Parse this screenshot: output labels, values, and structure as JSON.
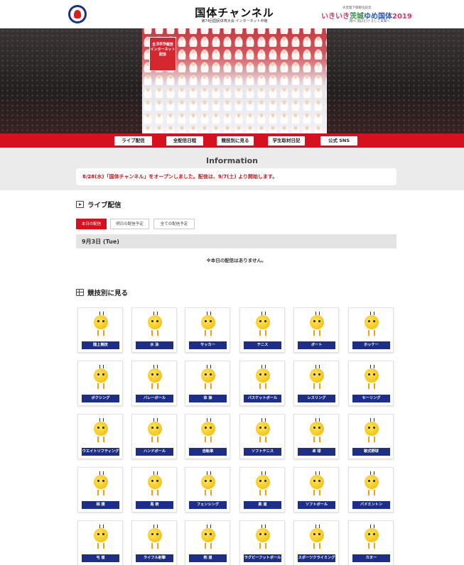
{
  "header": {
    "title": "国体チャンネル",
    "subtitle": "第74回国民体育大会 インターネット中継",
    "right_logo": {
      "small": "天皇陛下御即位記念",
      "name_part1": "いきいき",
      "name_part2": "茨城",
      "name_part3": "ゆめ国体",
      "year": "2019",
      "tagline": "翔べ 羽ばたけ そして未来へ"
    }
  },
  "hero": {
    "badge_line1": "全",
    "badge_number": "389",
    "badge_line2": "競技",
    "badge_line3": "インターネット",
    "badge_line4": "配信"
  },
  "nav": [
    {
      "label": "ライブ配信"
    },
    {
      "label": "全配信日程"
    },
    {
      "label": "競技別に見る"
    },
    {
      "label": "学生取材日記"
    },
    {
      "label": "公式 SNS"
    }
  ],
  "information": {
    "title": "Information",
    "message": "8/28(水)「国体チャンネル」をオープンしました。配信は、9/7(土) より開始します。"
  },
  "live": {
    "heading": "ライブ配信",
    "tabs": [
      {
        "label": "本日の配信",
        "active": true
      },
      {
        "label": "明日の配信予定",
        "active": false
      },
      {
        "label": "全ての配信予定",
        "active": false
      }
    ],
    "date": "9月3日 (Tue)",
    "empty_message": "※本日の配信はありません。"
  },
  "sports": {
    "heading": "競技別に見る",
    "items": [
      {
        "label": "陸上競技",
        "icon": "running-mascot-icon"
      },
      {
        "label": "水 泳",
        "icon": "swimming-mascot-icon"
      },
      {
        "label": "サッカー",
        "icon": "soccer-mascot-icon"
      },
      {
        "label": "テニス",
        "icon": "tennis-mascot-icon"
      },
      {
        "label": "ボート",
        "icon": "rowing-mascot-icon"
      },
      {
        "label": "ホッケー",
        "icon": "hockey-mascot-icon"
      },
      {
        "label": "ボクシング",
        "icon": "boxing-mascot-icon"
      },
      {
        "label": "バレーボール",
        "icon": "volleyball-mascot-icon"
      },
      {
        "label": "体 操",
        "icon": "gymnastics-mascot-icon"
      },
      {
        "label": "バスケットボール",
        "icon": "basketball-mascot-icon"
      },
      {
        "label": "レスリング",
        "icon": "wrestling-mascot-icon"
      },
      {
        "label": "セーリング",
        "icon": "sailing-mascot-icon"
      },
      {
        "label": "ウエイトリフティング",
        "icon": "weightlifting-mascot-icon"
      },
      {
        "label": "ハンドボール",
        "icon": "handball-mascot-icon"
      },
      {
        "label": "自転車",
        "icon": "cycling-mascot-icon"
      },
      {
        "label": "ソフトテニス",
        "icon": "soft-tennis-mascot-icon"
      },
      {
        "label": "卓 球",
        "icon": "table-tennis-mascot-icon"
      },
      {
        "label": "軟式野球",
        "icon": "baseball-mascot-icon"
      },
      {
        "label": "相 撲",
        "icon": "sumo-mascot-icon"
      },
      {
        "label": "馬 術",
        "icon": "equestrian-mascot-icon"
      },
      {
        "label": "フェンシング",
        "icon": "fencing-mascot-icon"
      },
      {
        "label": "柔 道",
        "icon": "judo-mascot-icon"
      },
      {
        "label": "ソフトボール",
        "icon": "softball-mascot-icon"
      },
      {
        "label": "バドミントン",
        "icon": "badminton-mascot-icon"
      },
      {
        "label": "弓 道",
        "icon": "archery-mascot-icon"
      },
      {
        "label": "ライフル射撃",
        "icon": "rifle-mascot-icon"
      },
      {
        "label": "剣 道",
        "icon": "kendo-mascot-icon"
      },
      {
        "label": "ラグビーフットボール",
        "icon": "rugby-mascot-icon"
      },
      {
        "label": "スポーツクライミング",
        "icon": "climbing-mascot-icon"
      },
      {
        "label": "カヌー",
        "icon": "canoe-mascot-icon"
      }
    ]
  },
  "colors": {
    "brand_red": "#d6101e",
    "label_navy": "#1c2e8a",
    "info_red": "#c8141e"
  }
}
